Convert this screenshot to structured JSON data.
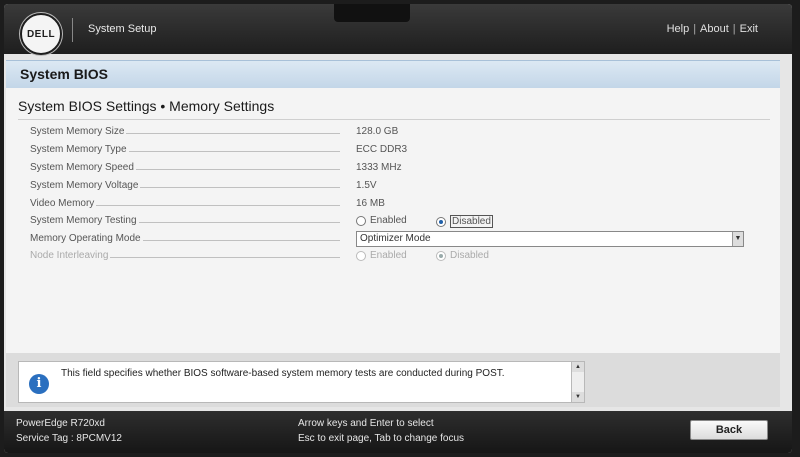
{
  "header": {
    "logo_text": "DELL",
    "app_title": "System Setup",
    "links": [
      "Help",
      "About",
      "Exit"
    ]
  },
  "page": {
    "title": "System BIOS"
  },
  "section": {
    "title": "System BIOS Settings • Memory Settings",
    "rows": [
      {
        "label": "System Memory Size",
        "value": "128.0 GB"
      },
      {
        "label": "System Memory Type",
        "value": "ECC DDR3"
      },
      {
        "label": "System Memory Speed",
        "value": "1333 MHz"
      },
      {
        "label": "System Memory Voltage",
        "value": "1.5V"
      },
      {
        "label": "Video Memory",
        "value": "16 MB"
      },
      {
        "label": "System Memory Testing",
        "options": [
          "Enabled",
          "Disabled"
        ],
        "selected": "Disabled"
      },
      {
        "label": "Memory Operating Mode",
        "value": "Optimizer Mode"
      },
      {
        "label": "Node Interleaving",
        "options": [
          "Enabled",
          "Disabled"
        ],
        "selected": "Disabled",
        "disabled": true
      }
    ]
  },
  "help": {
    "text": "This field specifies whether BIOS software-based system memory tests are conducted during POST."
  },
  "footer": {
    "model": "PowerEdge R720xd",
    "service_tag": "Service Tag : 8PCMV12",
    "hint_line1": "Arrow keys and Enter to select",
    "hint_line2": "Esc to exit page, Tab to change focus",
    "back_label": "Back"
  },
  "colors": {
    "accent": "#2a6fbf",
    "band": "#c3d6e8",
    "header_bg": "#1e1e1e"
  }
}
